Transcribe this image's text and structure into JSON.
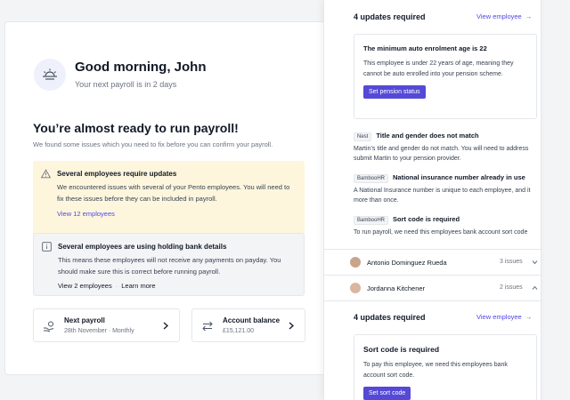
{
  "dashboard": {
    "greeting": "Good morning, John",
    "next_payroll_note": "Your next payroll is in 2 days",
    "ready_title": "You’re almost ready to run payroll!",
    "ready_subtitle": "We found some issues which you need to fix before you can confirm your payroll.",
    "alerts": [
      {
        "title": "Several employees require updates",
        "body": "We encountered issues with several of your Pento employees. You will need to fix these issues before they can be included in payroll.",
        "link": "View 12 employees"
      },
      {
        "title": "Several employees are using holding bank details",
        "body": "This means these employees will not receive any payments on payday. You should make sure this is correct before running payroll.",
        "link_primary": "View 2 employees",
        "link_secondary": "Learn more"
      }
    ],
    "tiles": [
      {
        "title": "Next payroll",
        "subtitle": "28th November · Monthly"
      },
      {
        "title": "Account balance",
        "subtitle": "£15,121.00"
      }
    ]
  },
  "panel": {
    "section_top": {
      "heading": "4 updates required",
      "view_link": "View employee",
      "card": {
        "title": "The minimum auto enrolment age is 22",
        "body": "This employee is under 22 years of age, meaning they cannot be auto enrolled into your pension scheme.",
        "button": "Set pension status"
      },
      "issues": [
        {
          "tag": "Nest",
          "title": "Title and gender does not match",
          "body": "Martin’s title and gender do not match. You will need to address",
          "body2": "submit Martin to your pension provider."
        },
        {
          "tag": "BambooHR",
          "title": "National insurance number already in use",
          "body": "A National Insurance number is unique to each employee, and it",
          "body2": "more than once."
        },
        {
          "tag": "BambooHR",
          "title": "Sort code is required",
          "body": "To run payroll, we need this employees bank account sort code"
        }
      ]
    },
    "employees": [
      {
        "name": "Antonio Dominguez Rueda",
        "issues": "3 issues"
      },
      {
        "name": "Jordanna Kitchener",
        "issues": "2 issues"
      }
    ],
    "section_bottom": {
      "heading": "4 updates required",
      "view_link": "View employee",
      "card": {
        "title": "Sort code is required",
        "body": "To pay this employee, we need this employees bank account sort code.",
        "button": "Set sort code"
      }
    }
  },
  "colors": {
    "accent": "#5549d6",
    "link": "#4f46e5",
    "warning_bg": "#fdf6dd",
    "info_bg": "#f3f4f6"
  }
}
